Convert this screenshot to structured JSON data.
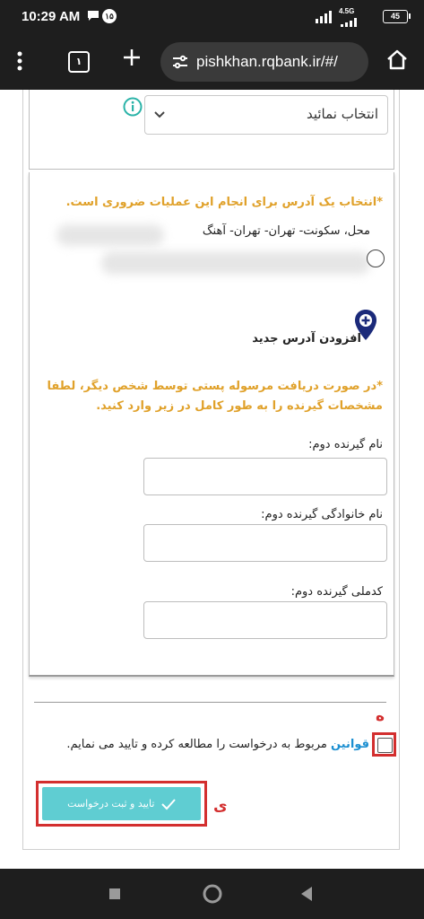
{
  "status_bar": {
    "time": "10:29 AM",
    "notification_badge": "۱۵",
    "network": "4.5G",
    "battery": "45",
    "icons": [
      "chat-bubble-icon",
      "numbered-badge-icon",
      "signal-icon",
      "battery-icon"
    ]
  },
  "browser": {
    "url": "pishkhan.rqbank.ir/#/",
    "tabs_count": "۱",
    "icons": [
      "more-vert-icon",
      "tabs-icon",
      "plus-icon",
      "site-settings-icon",
      "home-icon"
    ]
  },
  "form": {
    "select_placeholder": "انتخاب نمائید",
    "address_required_note": "*انتخاب یک آدرس برای انجام این عملیات ضروری است.",
    "address_option_text": "محل، سکونت- تهران- تهران- آهنگ",
    "add_address_label": "افزودن آدرس جدید",
    "second_receiver_note": "*در صورت دریافت مرسوله پستی توسط شخص دیگر، لطفا مشخصات گیرنده را به طور کامل در زیر وارد کنید.",
    "first_name_label": "نام گیرنده دوم:",
    "last_name_label": "نام خانوادگی گیرنده دوم:",
    "national_code_label": "کدملی گیرنده دوم:",
    "first_name_value": "",
    "last_name_value": "",
    "national_code_value": ""
  },
  "terms": {
    "link_text": "قوانین",
    "text": " مربوط به درخواست را مطالعه کرده و تایید می نمایم.",
    "checked": false
  },
  "submit": {
    "label": "تایید و ثبت درخواست"
  },
  "annotations": {
    "label_he": "ه",
    "label_ye": "ی",
    "color": "#d32f2f"
  },
  "colors": {
    "warning_text": "#e0a12a",
    "link": "#1c8fd1",
    "button": "#5fcdd2",
    "pin_icon": "#1b2a7a",
    "info_icon": "#2bb3a8"
  }
}
